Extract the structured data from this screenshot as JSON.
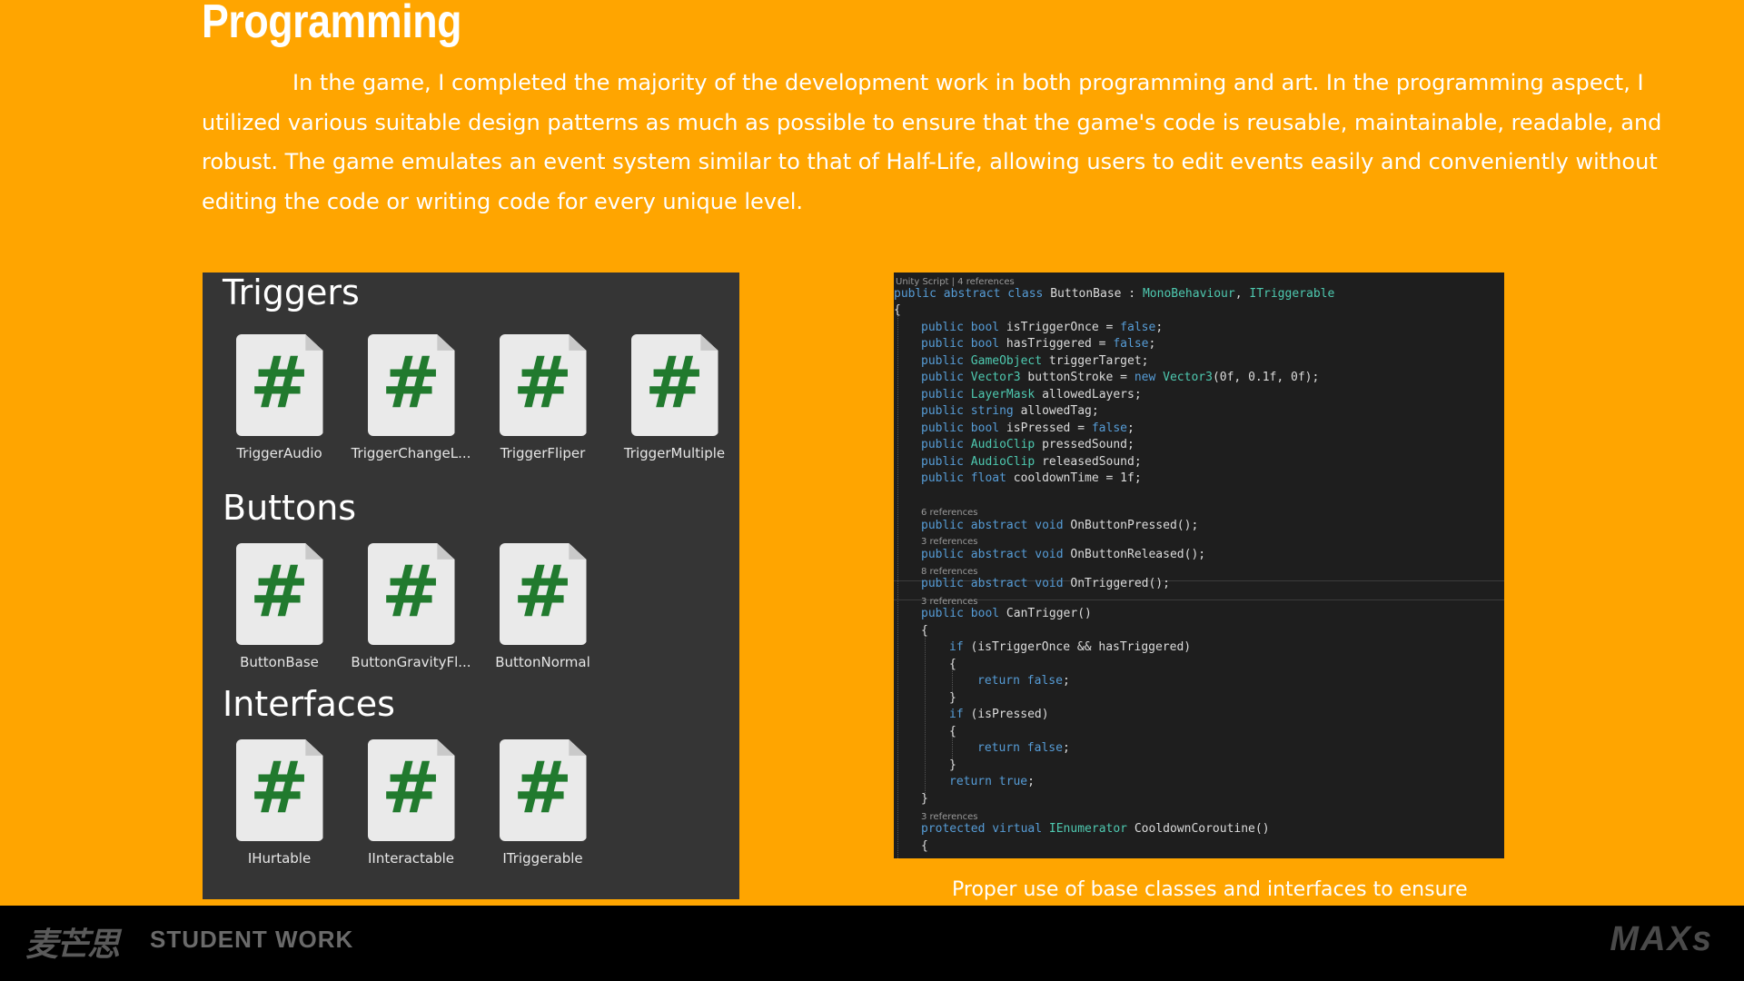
{
  "slide": {
    "title": "Programming",
    "intro": "In the game, I completed the majority of the development work in both programming and art. In the programming aspect, I utilized various suitable design patterns as much as possible to ensure that the game's code is reusable, maintainable, readable, and robust. The game emulates an event system similar to that of Half-Life, allowing users to edit events easily and conveniently without editing the code or writing code for every unique level.",
    "caption": "Proper use of base classes and interfaces to ensure"
  },
  "assets": {
    "icon_glyph": "#",
    "icon_name": "csharp-script-icon",
    "sections": [
      {
        "heading": "Triggers",
        "items": [
          "TriggerAudio",
          "TriggerChangeL...",
          "TriggerFliper",
          "TriggerMultiple"
        ]
      },
      {
        "heading": "Buttons",
        "items": [
          "ButtonBase",
          "ButtonGravityFl...",
          "ButtonNormal"
        ]
      },
      {
        "heading": "Interfaces",
        "items": [
          "IHurtable",
          "IInteractable",
          "ITriggerable"
        ]
      }
    ]
  },
  "code": {
    "header": "Unity Script | 4 references",
    "class_decl": "public abstract class ButtonBase : MonoBehaviour, ITriggerable",
    "fields": [
      "public bool isTriggerOnce = false;",
      "public bool hasTriggered = false;",
      "public GameObject triggerTarget;",
      "public Vector3 buttonStroke = new Vector3(0f, 0.1f, 0f);",
      "public LayerMask allowedLayers;",
      "public string allowedTag;",
      "public bool isPressed = false;",
      "public AudioClip pressedSound;",
      "public AudioClip releasedSound;",
      "public float cooldownTime = 1f;"
    ],
    "ref_6": "6 references",
    "ref_3a": "3 references",
    "ref_8": "8 references",
    "ref_3b": "3 references",
    "ref_3c": "3 references",
    "on_pressed": "public abstract void OnButtonPressed();",
    "on_released": "public abstract void OnButtonReleased();",
    "on_triggered": "public abstract void OnTriggered();",
    "can_trigger": "public bool CanTrigger()",
    "if1": "if (isTriggerOnce && hasTriggered)",
    "return_false": "return false;",
    "if2": "if (isPressed)",
    "return_true": "return true;",
    "cooldown": "protected virtual IEnumerator CooldownCoroutine()",
    "open_brace": "{",
    "close_brace": "}"
  },
  "footer": {
    "logo_cn": "麦芒思",
    "student_work": "STUDENT WORK",
    "brand": "MAXs"
  },
  "colors": {
    "background": "#FFA500",
    "panel": "#353535",
    "code_bg": "#1e1e1e",
    "hash_green": "#217a2e",
    "keyword": "#569cd6",
    "type": "#4ec9b0"
  }
}
